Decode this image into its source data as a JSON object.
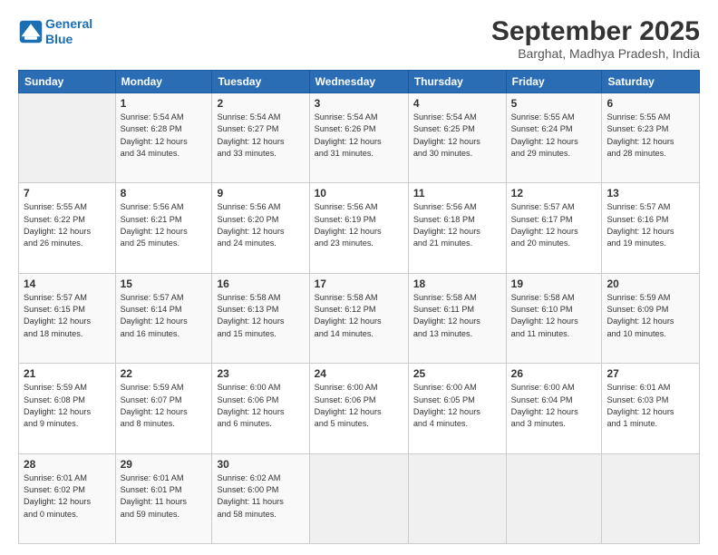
{
  "header": {
    "logo_line1": "General",
    "logo_line2": "Blue",
    "month": "September 2025",
    "location": "Barghat, Madhya Pradesh, India"
  },
  "days_of_week": [
    "Sunday",
    "Monday",
    "Tuesday",
    "Wednesday",
    "Thursday",
    "Friday",
    "Saturday"
  ],
  "weeks": [
    [
      {
        "day": "",
        "info": ""
      },
      {
        "day": "1",
        "info": "Sunrise: 5:54 AM\nSunset: 6:28 PM\nDaylight: 12 hours\nand 34 minutes."
      },
      {
        "day": "2",
        "info": "Sunrise: 5:54 AM\nSunset: 6:27 PM\nDaylight: 12 hours\nand 33 minutes."
      },
      {
        "day": "3",
        "info": "Sunrise: 5:54 AM\nSunset: 6:26 PM\nDaylight: 12 hours\nand 31 minutes."
      },
      {
        "day": "4",
        "info": "Sunrise: 5:54 AM\nSunset: 6:25 PM\nDaylight: 12 hours\nand 30 minutes."
      },
      {
        "day": "5",
        "info": "Sunrise: 5:55 AM\nSunset: 6:24 PM\nDaylight: 12 hours\nand 29 minutes."
      },
      {
        "day": "6",
        "info": "Sunrise: 5:55 AM\nSunset: 6:23 PM\nDaylight: 12 hours\nand 28 minutes."
      }
    ],
    [
      {
        "day": "7",
        "info": "Sunrise: 5:55 AM\nSunset: 6:22 PM\nDaylight: 12 hours\nand 26 minutes."
      },
      {
        "day": "8",
        "info": "Sunrise: 5:56 AM\nSunset: 6:21 PM\nDaylight: 12 hours\nand 25 minutes."
      },
      {
        "day": "9",
        "info": "Sunrise: 5:56 AM\nSunset: 6:20 PM\nDaylight: 12 hours\nand 24 minutes."
      },
      {
        "day": "10",
        "info": "Sunrise: 5:56 AM\nSunset: 6:19 PM\nDaylight: 12 hours\nand 23 minutes."
      },
      {
        "day": "11",
        "info": "Sunrise: 5:56 AM\nSunset: 6:18 PM\nDaylight: 12 hours\nand 21 minutes."
      },
      {
        "day": "12",
        "info": "Sunrise: 5:57 AM\nSunset: 6:17 PM\nDaylight: 12 hours\nand 20 minutes."
      },
      {
        "day": "13",
        "info": "Sunrise: 5:57 AM\nSunset: 6:16 PM\nDaylight: 12 hours\nand 19 minutes."
      }
    ],
    [
      {
        "day": "14",
        "info": "Sunrise: 5:57 AM\nSunset: 6:15 PM\nDaylight: 12 hours\nand 18 minutes."
      },
      {
        "day": "15",
        "info": "Sunrise: 5:57 AM\nSunset: 6:14 PM\nDaylight: 12 hours\nand 16 minutes."
      },
      {
        "day": "16",
        "info": "Sunrise: 5:58 AM\nSunset: 6:13 PM\nDaylight: 12 hours\nand 15 minutes."
      },
      {
        "day": "17",
        "info": "Sunrise: 5:58 AM\nSunset: 6:12 PM\nDaylight: 12 hours\nand 14 minutes."
      },
      {
        "day": "18",
        "info": "Sunrise: 5:58 AM\nSunset: 6:11 PM\nDaylight: 12 hours\nand 13 minutes."
      },
      {
        "day": "19",
        "info": "Sunrise: 5:58 AM\nSunset: 6:10 PM\nDaylight: 12 hours\nand 11 minutes."
      },
      {
        "day": "20",
        "info": "Sunrise: 5:59 AM\nSunset: 6:09 PM\nDaylight: 12 hours\nand 10 minutes."
      }
    ],
    [
      {
        "day": "21",
        "info": "Sunrise: 5:59 AM\nSunset: 6:08 PM\nDaylight: 12 hours\nand 9 minutes."
      },
      {
        "day": "22",
        "info": "Sunrise: 5:59 AM\nSunset: 6:07 PM\nDaylight: 12 hours\nand 8 minutes."
      },
      {
        "day": "23",
        "info": "Sunrise: 6:00 AM\nSunset: 6:06 PM\nDaylight: 12 hours\nand 6 minutes."
      },
      {
        "day": "24",
        "info": "Sunrise: 6:00 AM\nSunset: 6:06 PM\nDaylight: 12 hours\nand 5 minutes."
      },
      {
        "day": "25",
        "info": "Sunrise: 6:00 AM\nSunset: 6:05 PM\nDaylight: 12 hours\nand 4 minutes."
      },
      {
        "day": "26",
        "info": "Sunrise: 6:00 AM\nSunset: 6:04 PM\nDaylight: 12 hours\nand 3 minutes."
      },
      {
        "day": "27",
        "info": "Sunrise: 6:01 AM\nSunset: 6:03 PM\nDaylight: 12 hours\nand 1 minute."
      }
    ],
    [
      {
        "day": "28",
        "info": "Sunrise: 6:01 AM\nSunset: 6:02 PM\nDaylight: 12 hours\nand 0 minutes."
      },
      {
        "day": "29",
        "info": "Sunrise: 6:01 AM\nSunset: 6:01 PM\nDaylight: 11 hours\nand 59 minutes."
      },
      {
        "day": "30",
        "info": "Sunrise: 6:02 AM\nSunset: 6:00 PM\nDaylight: 11 hours\nand 58 minutes."
      },
      {
        "day": "",
        "info": ""
      },
      {
        "day": "",
        "info": ""
      },
      {
        "day": "",
        "info": ""
      },
      {
        "day": "",
        "info": ""
      }
    ]
  ]
}
